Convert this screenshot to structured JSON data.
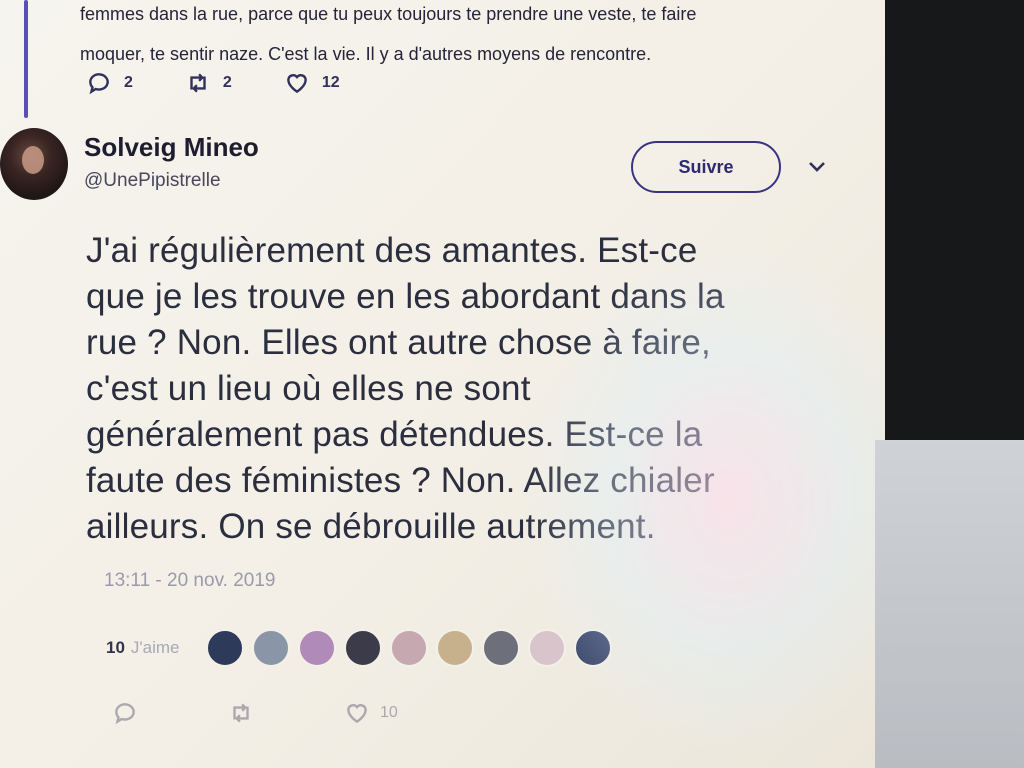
{
  "previous_tweet": {
    "text_lines": [
      "femmes dans la rue, parce que tu peux toujours te prendre une veste, te faire",
      "moquer, te sentir naze. C'est la vie. Il y a d'autres moyens de rencontre."
    ],
    "replies": "2",
    "retweets": "2",
    "likes": "12"
  },
  "tweet": {
    "author_name": "Solveig Mineo",
    "author_handle": "@UnePipistrelle",
    "follow_label": "Suivre",
    "body_lines": [
      "J'ai régulièrement des amantes. Est-ce",
      "que je les trouve en les abordant dans la",
      "rue ? Non. Elles ont autre chose à faire,",
      "c'est un lieu où elles ne sont",
      "généralement pas détendues. Est-ce la",
      "faute des féministes ? Non. Allez chialer",
      "ailleurs. On se débrouille autrement."
    ],
    "timestamp": "13:11 - 20 nov. 2019",
    "like_count": "10",
    "like_label": "J'aime",
    "bottom_likes": "10"
  },
  "likers": [
    {
      "color": "#2d3a5a"
    },
    {
      "color": "#8a95a8"
    },
    {
      "color": "#b08ab8"
    },
    {
      "color": "#3b3b4a"
    },
    {
      "color": "#c6a8b0"
    },
    {
      "color": "#c7b08c"
    },
    {
      "color": "#6d6f7a"
    },
    {
      "color": "#d9c4cc"
    },
    {
      "color": "#3e4a6e"
    }
  ],
  "colors": {
    "accent": "#3a3480",
    "text": "#2b2e3e",
    "muted": "#9a9aa8"
  },
  "icons": [
    "reply-icon",
    "retweet-icon",
    "heart-icon",
    "chevron-down-icon"
  ]
}
